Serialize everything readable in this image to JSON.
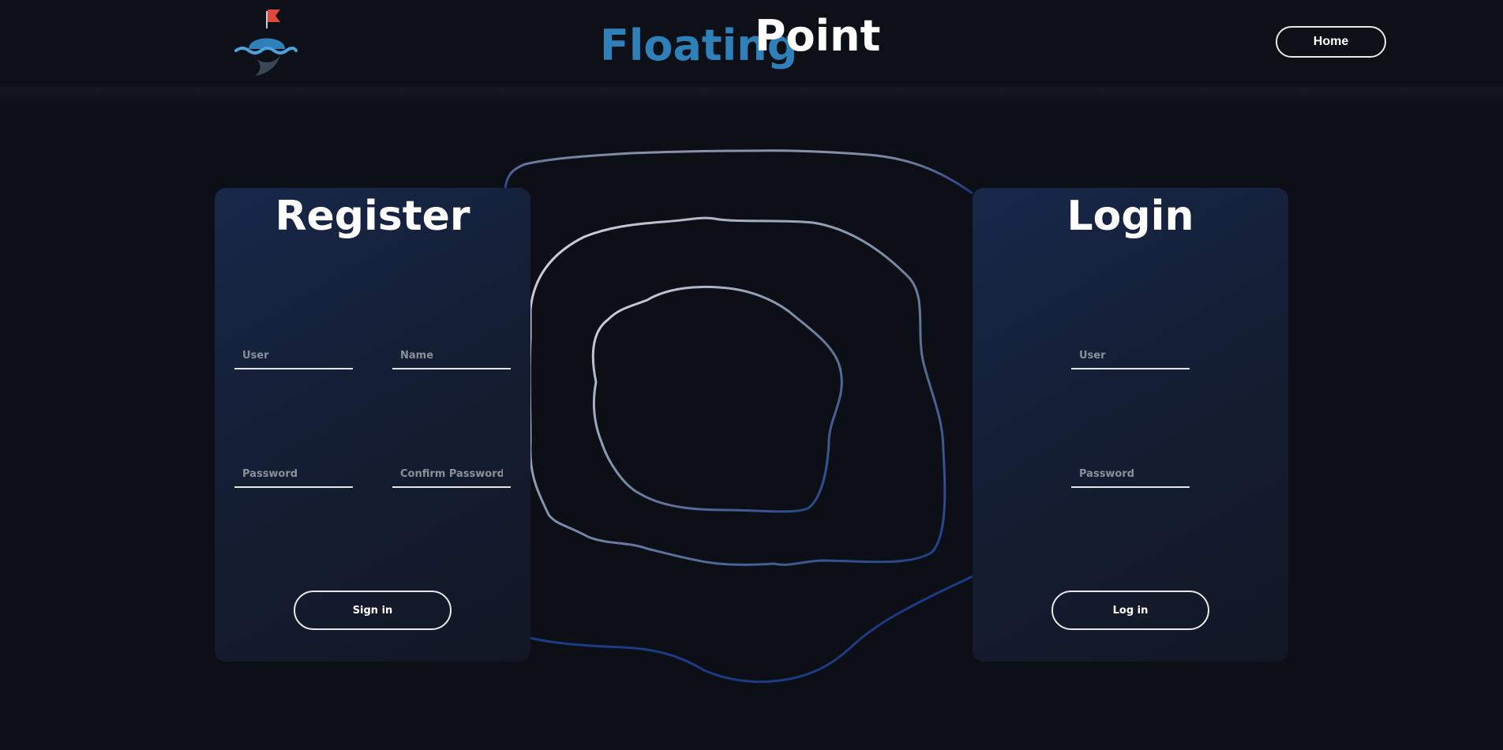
{
  "header": {
    "brand_part1": "Floating",
    "brand_part2": "Point",
    "home_label": "Home",
    "logo_icon": "buoy-flag-logo-icon"
  },
  "register": {
    "title": "Register",
    "fields": {
      "user_placeholder": "User",
      "name_placeholder": "Name",
      "password_placeholder": "Password",
      "confirm_password_placeholder": "Confirm Password"
    },
    "submit_label": "Sign in"
  },
  "login": {
    "title": "Login",
    "fields": {
      "user_placeholder": "User",
      "password_placeholder": "Password"
    },
    "submit_label": "Log in"
  },
  "colors": {
    "background": "#0c0f16",
    "brand_blue": "#2f7fb8",
    "flag_red": "#e04a3c",
    "panel_gradient_start": "#17284a"
  }
}
